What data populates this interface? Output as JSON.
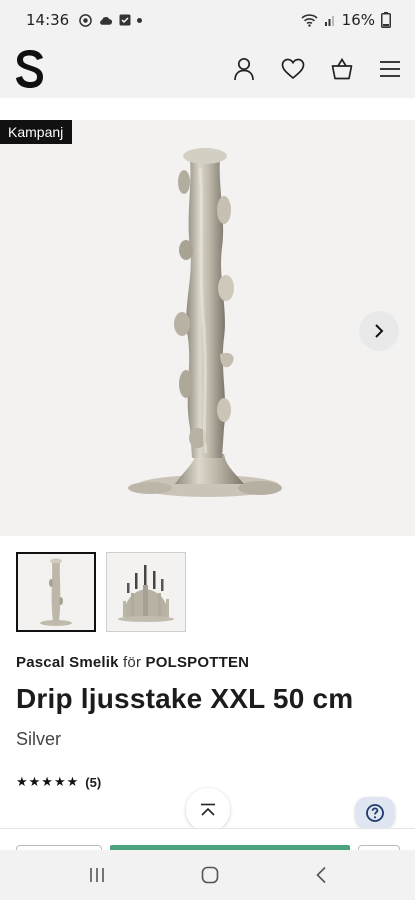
{
  "status_bar": {
    "time": "14:36",
    "battery": "16%"
  },
  "header": {
    "logo_letter": "S",
    "icons": [
      "account-icon",
      "heart-icon",
      "basket-icon",
      "menu-icon"
    ]
  },
  "gallery": {
    "badge": "Kampanj",
    "image_alt": "Drip ljusstake XXL 50 cm"
  },
  "thumbnails": [
    {
      "name": "thumbnail-candlestick",
      "selected": true
    },
    {
      "name": "thumbnail-candelabra-group",
      "selected": false
    }
  ],
  "product": {
    "designer": "Pascal Smelik",
    "for_word": "för",
    "brand": "POLSPOTTEN",
    "title": "Drip ljusstake XXL 50 cm",
    "variant": "Silver",
    "stars": "★★★★★",
    "rating_value": 5,
    "review_count": "(5)"
  },
  "colors": {
    "accent_green": "#4aa37c",
    "help_bg": "#dfe6f1",
    "badge_bg": "#111111"
  }
}
